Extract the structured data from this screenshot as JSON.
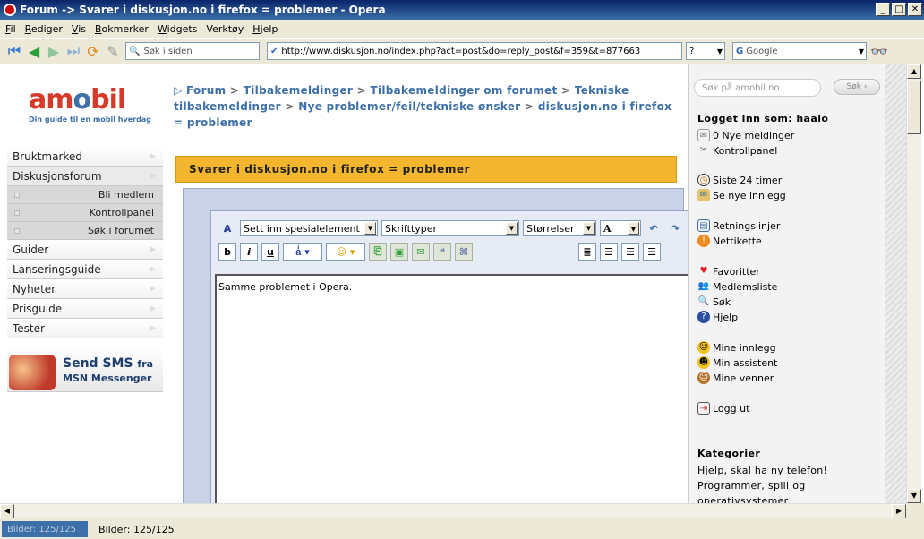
{
  "window": {
    "title": "Forum -> Svarer i diskusjon.no i firefox = problemer - Opera"
  },
  "menubar": [
    {
      "u": "F",
      "rest": "il"
    },
    {
      "u": "R",
      "rest": "ediger"
    },
    {
      "u": "V",
      "rest": "is"
    },
    {
      "u": "B",
      "rest": "okmerker"
    },
    {
      "u": "W",
      "rest": "idgets"
    },
    {
      "u": "",
      "rest": "Verktøy"
    },
    {
      "u": "H",
      "rest": "jelp"
    }
  ],
  "toolbar": {
    "page_search_placeholder": "Søk i siden",
    "address": "http://www.diskusjon.no/index.php?act=post&do=reply_post&f=359&t=877663",
    "help_label": "?",
    "search_engine": "Google"
  },
  "logo": {
    "word_a": "am",
    "word_b": "o",
    "word_c": "bil",
    "tagline": "Din guide til en mobil hverdag"
  },
  "leftmenu": {
    "items": [
      "Bruktmarked",
      "Diskusjonsforum"
    ],
    "sub": [
      "Bli medlem",
      "Kontrollpanel",
      "Søk i forumet"
    ],
    "items2": [
      "Guider",
      "Lanseringsguide",
      "Nyheter",
      "Prisguide",
      "Tester"
    ]
  },
  "sms": {
    "line1": "Send SMS",
    "line1b": "fra",
    "line2": "MSN Messenger"
  },
  "breadcrumb": {
    "prefix": "▷",
    "parts": [
      "Forum",
      "Tilbakemeldinger",
      "Tilbakemeldinger om forumet",
      "Tekniske tilbakemeldinger",
      "Nye problemer/feil/tekniske ønsker",
      "diskusjon.no i firefox = problemer"
    ],
    "sep": ">"
  },
  "panel": {
    "header": "Svarer i diskusjon.no i firefox = problemer"
  },
  "editor": {
    "special": "Sett inn spesialelement",
    "fonts": "Skrifttyper",
    "sizes": "Størrelser",
    "fontcolor": "A",
    "text": "Samme problemet i Opera."
  },
  "right": {
    "search_placeholder": "Søk på amobil.no",
    "search_btn": "Søk ›",
    "logged": "Logget inn som: haalo",
    "links1": [
      "0 Nye meldinger",
      "Kontrollpanel"
    ],
    "links2": [
      "Siste 24 timer",
      "Se nye innlegg"
    ],
    "links3": [
      "Retningslinjer",
      "Nettikette"
    ],
    "links4": [
      "Favoritter",
      "Medlemsliste",
      "Søk",
      "Hjelp"
    ],
    "links5": [
      "Mine innlegg",
      "Min assistent",
      "Mine venner"
    ],
    "logout": "Logg ut",
    "cat_title": "Kategorier",
    "cat_lines": [
      "Hjelp, skal ha ny telefon!",
      "Programmer, spill og",
      "operativsystemer"
    ]
  },
  "status": {
    "progress": "Bilder: 125/125",
    "text": "Bilder: 125/125"
  },
  "colors": {
    "accent": "#3d6fa8",
    "header": "#f4b62e"
  }
}
